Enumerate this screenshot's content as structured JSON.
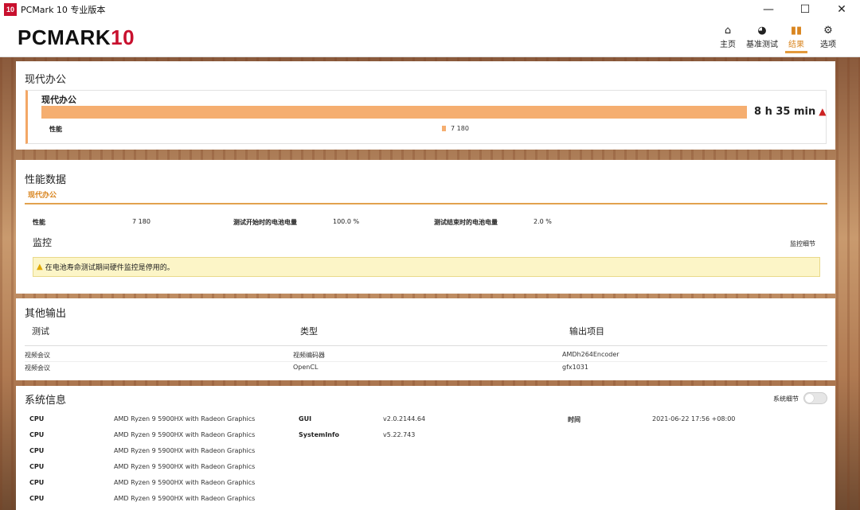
{
  "window": {
    "icon_text": "10",
    "title": "PCMark 10 专业版本"
  },
  "header": {
    "logo_main": "PCMARK",
    "logo_num": "10",
    "nav": [
      {
        "label": "主页",
        "icon": "home-icon"
      },
      {
        "label": "基准测试",
        "icon": "gauge-icon"
      },
      {
        "label": "结果",
        "icon": "bar-chart-icon",
        "active": true
      },
      {
        "label": "选项",
        "icon": "gear-icon"
      }
    ]
  },
  "summary": {
    "title": "现代办公",
    "card_title": "现代办公",
    "battery_life": "8 h 35 min",
    "perf_label": "性能",
    "perf_value": "7 180"
  },
  "perf_data": {
    "title": "性能数据",
    "tab": "现代办公",
    "rows": [
      {
        "label": "性能",
        "value": "7 180"
      },
      {
        "label": "测试开始时的电池电量",
        "value": "100.0 %"
      },
      {
        "label": "测试结束时的电池电量",
        "value": "2.0 %"
      }
    ],
    "monitor_title": "监控",
    "monitor_link": "监控细节",
    "alert": "在电池寿命测试期间硬件监控是停用的。"
  },
  "other_output": {
    "title": "其他输出",
    "headers": [
      "测试",
      "类型",
      "输出项目"
    ],
    "rows": [
      [
        "视频会议",
        "视频编码器",
        "AMDh264Encoder"
      ],
      [
        "视频会议",
        "OpenCL",
        "gfx1031"
      ]
    ]
  },
  "sysinfo": {
    "title": "系统信息",
    "toggle_label": "系统细节",
    "cpu_rows": [
      {
        "label": "CPU",
        "value": "AMD Ryzen 9 5900HX with Radeon Graphics"
      },
      {
        "label": "CPU",
        "value": "AMD Ryzen 9 5900HX with Radeon Graphics"
      },
      {
        "label": "CPU",
        "value": "AMD Ryzen 9 5900HX with Radeon Graphics"
      },
      {
        "label": "CPU",
        "value": "AMD Ryzen 9 5900HX with Radeon Graphics"
      },
      {
        "label": "CPU",
        "value": "AMD Ryzen 9 5900HX with Radeon Graphics"
      },
      {
        "label": "CPU",
        "value": "AMD Ryzen 9 5900HX with Radeon Graphics"
      }
    ],
    "gui_label": "GUI",
    "gui_value": "v2.0.2144.64",
    "sysinfo_label": "SystemInfo",
    "sysinfo_value": "v5.22.743",
    "time_label": "时间",
    "time_value": "2021-06-22 17:56 +08:00"
  },
  "colors": {
    "accent": "#e39a3c",
    "bar": "#f5ae70",
    "logo_red": "#c8102e",
    "warning": "#c22222"
  }
}
